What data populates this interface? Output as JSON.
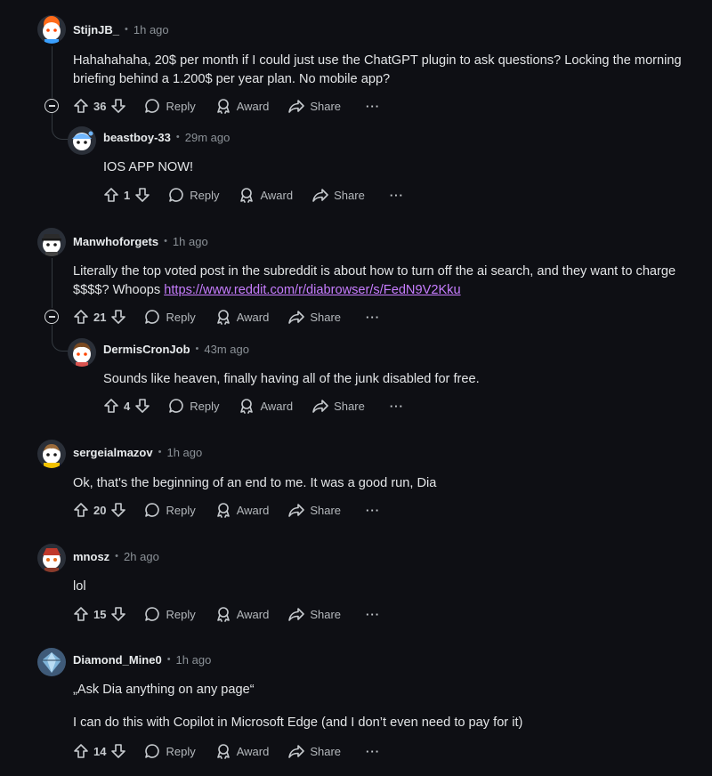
{
  "comments": [
    {
      "author": "StijnJB_",
      "time": "1h ago",
      "avatar": "avatar-orange-hair",
      "body": "Hahahahaha, 20$ per month if I could just use the ChatGPT plugin to ask questions? Locking the morning",
      "body2": "briefing behind a 1.200$ per year plan. No mobile app?",
      "votes": "36"
    },
    {
      "author": "beastboy-33",
      "time": "29m ago",
      "avatar": "avatar-blue-helmet",
      "body": "IOS APP NOW!",
      "votes": "1"
    },
    {
      "author": "Manwhoforgets",
      "time": "1h ago",
      "avatar": "avatar-police-cap",
      "body": "Literally the top voted post in the subreddit is about how to turn off the ai search, and they want to charge",
      "body2_prefix": "$$$$? Whoops ",
      "link": "https://www.reddit.com/r/diabrowser/s/FedN9V2Kku",
      "votes": "21"
    },
    {
      "author": "DermisCronJob",
      "time": "43m ago",
      "avatar": "avatar-brown-hair",
      "body": "Sounds like heaven, finally having all of the junk disabled for free.",
      "votes": "4"
    },
    {
      "author": "sergeialmazov",
      "time": "1h ago",
      "avatar": "avatar-yellow-shirt",
      "body": "Ok, that's the beginning of an end to me. It was a good run, Dia",
      "votes": "20"
    },
    {
      "author": "mnosz",
      "time": "2h ago",
      "avatar": "avatar-red-hat",
      "body": "lol",
      "votes": "15"
    },
    {
      "author": "Diamond_Mine0",
      "time": "1h ago",
      "avatar": "avatar-diamond",
      "body": "„Ask Dia anything on any page“",
      "body2": "I can do this with Copilot in Microsoft Edge (and I don’t even need to pay for it)",
      "votes": "14"
    }
  ],
  "labels": {
    "reply": "Reply",
    "award": "Award",
    "share": "Share",
    "more": "···",
    "dot": "•"
  },
  "colors": {
    "background": "#0e0f14",
    "link": "#c77dff",
    "text": "#e3e5e7",
    "meta": "#8b9197"
  }
}
